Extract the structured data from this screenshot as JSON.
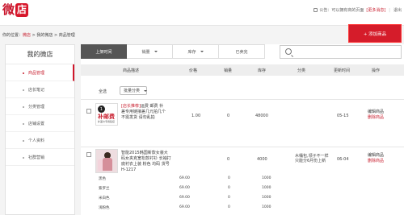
{
  "header": {
    "logo_part1": "微",
    "logo_part2": "店",
    "notice": "公告：",
    "notice_text": "可以拥有商的页面",
    "notice_link": "[更多消息]",
    "logout": "退出"
  },
  "breadcrumb": {
    "prefix": "你的位置：",
    "items": [
      "微店",
      "我的微店",
      "商品管理"
    ],
    "separator": " > "
  },
  "add_button": "+ 添加商品",
  "sidebar": {
    "title": "我的微店",
    "items": [
      {
        "label": "商品管理",
        "active": true
      },
      {
        "label": "店长笔记",
        "active": false
      },
      {
        "label": "分类管理",
        "active": false
      },
      {
        "label": "店铺设置",
        "active": false
      },
      {
        "label": "个人资料",
        "active": false
      },
      {
        "label": "社群营销",
        "active": false
      }
    ]
  },
  "tabs": [
    {
      "label": "上架时间",
      "active": true,
      "arrow": false
    },
    {
      "label": "销量",
      "active": false,
      "arrow": true
    },
    {
      "label": "库存",
      "active": false,
      "arrow": true
    },
    {
      "label": "已卖完",
      "active": false,
      "arrow": false
    }
  ],
  "search": {
    "placeholder": ""
  },
  "table": {
    "headers": [
      "商品描述",
      "价格",
      "销量",
      "库存",
      "分类",
      "更新时间",
      "操作"
    ],
    "select_all": "全选",
    "batch_label": "批量分类"
  },
  "products": [
    {
      "badge_number": "1",
      "badge_text": "补邮费",
      "badge_sub": "补差价专用链接",
      "tag": "[店长推荐]",
      "name": "运费 邮费 补差专用链接差几元拍几个 不需发货 请勿乱拍",
      "price": "1.00",
      "sales": "0",
      "stock": "48000",
      "category": "",
      "updated": "05-15",
      "edit": "编辑商品",
      "delete": "删除商品"
    },
    {
      "tag": "",
      "name": "智能2015韩国新款女装大码女夹克宽松款衬衫 长袖打底衬衣上装 粉色 均码 货号 H-1217",
      "price": "",
      "sales": "0",
      "stock": "4000",
      "category": "木桶包,领子不一样只能分6月份上新",
      "updated": "06-04",
      "edit": "编辑商品",
      "delete": "删除商品"
    }
  ],
  "variants": [
    {
      "color": "黑色",
      "price": "69.00",
      "sales": "0",
      "stock": "1000"
    },
    {
      "color": "紫罗兰",
      "price": "69.00",
      "sales": "0",
      "stock": "1000"
    },
    {
      "color": "米白色",
      "price": "69.00",
      "sales": "0",
      "stock": "1000"
    },
    {
      "color": "浅粉色",
      "price": "69.00",
      "sales": "0",
      "stock": "1000"
    }
  ],
  "colors": {
    "brand": "#d51c2a",
    "active_tab": "#555555"
  }
}
